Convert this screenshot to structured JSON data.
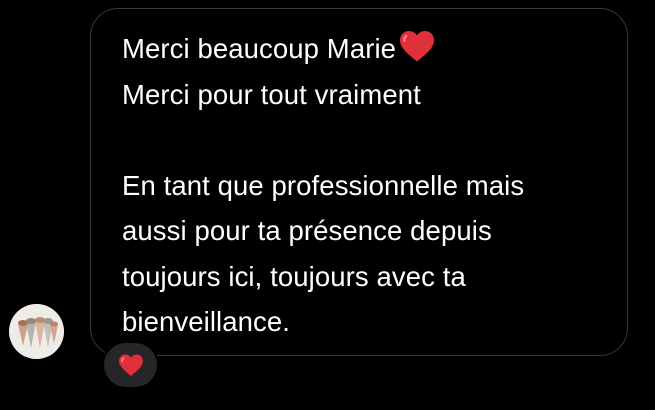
{
  "message": {
    "lines": [
      "Merci beaucoup Marie",
      "Merci pour tout vraiment",
      "",
      "En tant que professionnelle mais",
      "aussi pour ta présence depuis",
      "toujours ici, toujours avec ta",
      "bienveillance."
    ],
    "inline_emoji": "heart-emoji"
  },
  "reaction": {
    "emoji": "heart-emoji"
  },
  "colors": {
    "background": "#000000",
    "bubble_border": "#3a3a3c",
    "text": "#ffffff",
    "reaction_bg": "#262628",
    "heart": "#e0303a"
  }
}
